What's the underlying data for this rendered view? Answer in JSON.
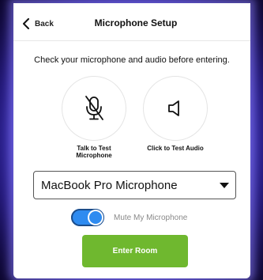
{
  "header": {
    "back_label": "Back",
    "title": "Microphone Setup"
  },
  "instruction": "Check your microphone and audio before entering.",
  "mic_test": {
    "label_line1": "Talk to Test",
    "label_line2": "Microphone",
    "icon": "microphone-off-icon"
  },
  "audio_test": {
    "label": "Click to Test Audio",
    "icon": "speaker-icon"
  },
  "device_select": {
    "selected": "MacBook Pro Microphone"
  },
  "mute_toggle": {
    "label": "Mute My Microphone",
    "on": true
  },
  "enter_button": {
    "label": "Enter Room"
  },
  "colors": {
    "accent_green": "#6fb82f",
    "toggle_blue": "#2e8bf0",
    "background_purple": "#4a3fd4"
  }
}
